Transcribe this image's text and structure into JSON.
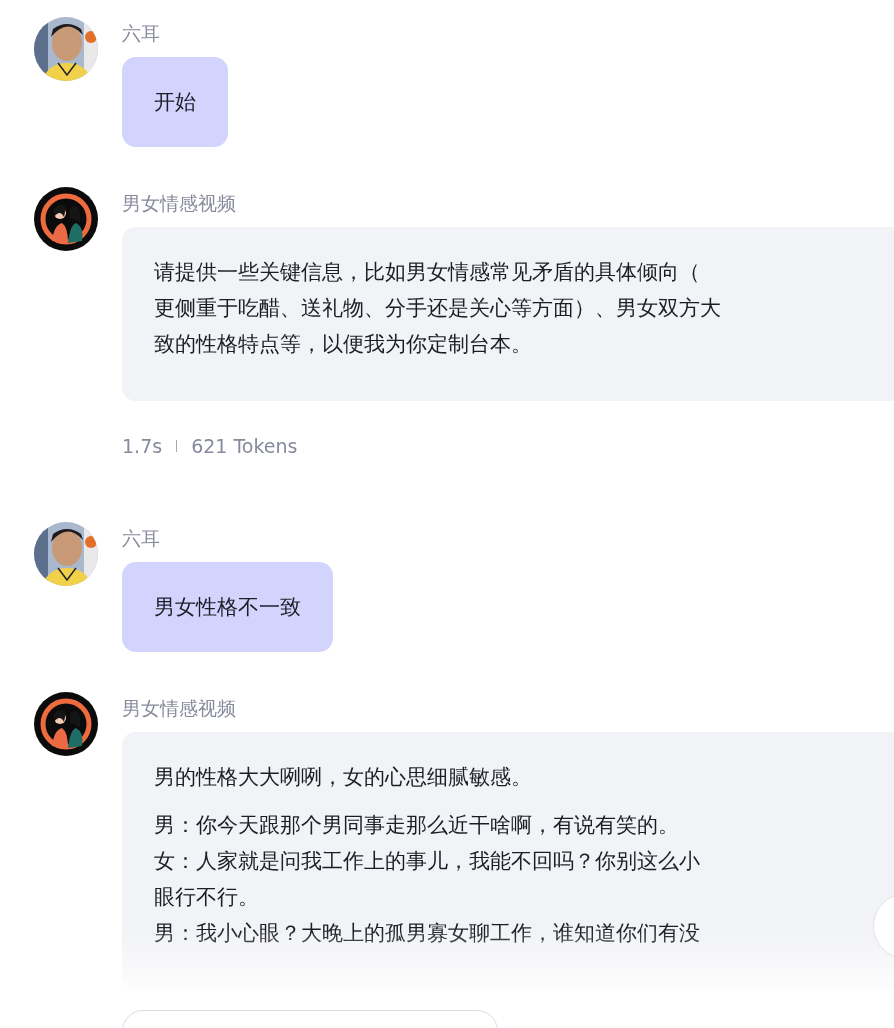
{
  "messages": [
    {
      "kind": "user",
      "sender": "六耳",
      "paragraphs": [
        [
          "开始"
        ]
      ]
    },
    {
      "kind": "bot",
      "sender": "男女情感视频",
      "paragraphs": [
        [
          "请提供一些关键信息，比如男女情感常见矛盾的具体倾向（",
          "更侧重于吃醋、送礼物、分手还是关心等方面）、男女双方大",
          "致的性格特点等，以便我为你定制台本。"
        ]
      ],
      "meta": {
        "time": "1.7s",
        "tokens": "621 Tokens"
      }
    },
    {
      "kind": "user",
      "sender": "六耳",
      "paragraphs": [
        [
          "男女性格不一致"
        ]
      ]
    },
    {
      "kind": "bot",
      "sender": "男女情感视频",
      "paragraphs": [
        [
          "男的性格大大咧咧，女的心思细腻敏感。"
        ],
        [
          "男：你今天跟那个男同事走那么近干啥啊，有说有笑的。",
          "女：人家就是问我工作上的事儿，我能不回吗？你别这么小",
          "眼行不行。",
          "男：我小心眼？大晚上的孤男寡女聊工作，谁知道你们有没"
        ]
      ]
    }
  ]
}
